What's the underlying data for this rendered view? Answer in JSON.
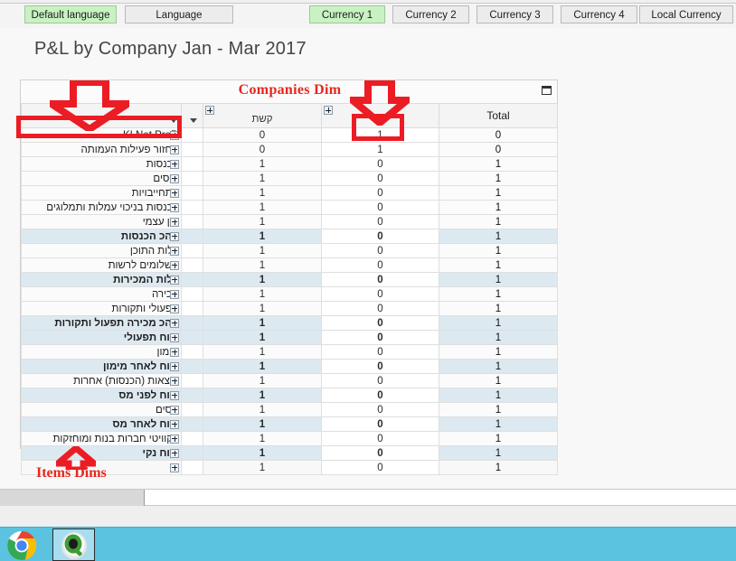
{
  "window": {
    "title": "P&L by Company Jan - Mar 2017"
  },
  "toolbar": {
    "language_tabs": [
      {
        "label": "Default language",
        "selected": true
      },
      {
        "label": "Language",
        "selected": false
      }
    ],
    "currency_tabs": [
      {
        "label": "Currency 1",
        "selected": true
      },
      {
        "label": "Currency 2",
        "selected": false
      },
      {
        "label": "Currency 3",
        "selected": false
      },
      {
        "label": "Currency 4",
        "selected": false
      },
      {
        "label": "Local Currency",
        "selected": false
      }
    ]
  },
  "pivot": {
    "caption": "Companies Dim",
    "maximize_icon": "maximize-icon",
    "headers": {
      "label": "",
      "tiny": "",
      "dim1": "קשת",
      "dim2": "",
      "total": "Total"
    },
    "rows": [
      {
        "label": "KI Net Profit",
        "dim1": "0",
        "dim2": "1",
        "total": "0",
        "highlight": false
      },
      {
        "label": "מחזור פעילות העמותה",
        "dim1": "0",
        "dim2": "1",
        "total": "0",
        "highlight": false
      },
      {
        "label": "הכנסות",
        "dim1": "1",
        "dim2": "0",
        "total": "1",
        "highlight": false
      },
      {
        "label": "נכסים",
        "dim1": "1",
        "dim2": "0",
        "total": "1",
        "highlight": false
      },
      {
        "label": "התחייבויות",
        "dim1": "1",
        "dim2": "0",
        "total": "1",
        "highlight": false
      },
      {
        "label": "הכנסות בניכוי עמלות ותמלוגים",
        "dim1": "1",
        "dim2": "0",
        "total": "1",
        "highlight": false
      },
      {
        "label": "הון עצמי",
        "dim1": "1",
        "dim2": "0",
        "total": "1",
        "highlight": false
      },
      {
        "label": "סהכ הכנסות",
        "dim1": "1",
        "dim2": "0",
        "total": "1",
        "highlight": true
      },
      {
        "label": "עלות התוכן",
        "dim1": "1",
        "dim2": "0",
        "total": "1",
        "highlight": false
      },
      {
        "label": "תשלומים לרשות",
        "dim1": "1",
        "dim2": "0",
        "total": "1",
        "highlight": false
      },
      {
        "label": "עלות המכירות",
        "dim1": "1",
        "dim2": "0",
        "total": "1",
        "highlight": true
      },
      {
        "label": "מכירה",
        "dim1": "1",
        "dim2": "0",
        "total": "1",
        "highlight": false
      },
      {
        "label": "תפעולי ותקורות",
        "dim1": "1",
        "dim2": "0",
        "total": "1",
        "highlight": false
      },
      {
        "label": "סהכ מכירה תפעול ותקורות",
        "dim1": "1",
        "dim2": "0",
        "total": "1",
        "highlight": true
      },
      {
        "label": "רווח תפעולי",
        "dim1": "1",
        "dim2": "0",
        "total": "1",
        "highlight": true
      },
      {
        "label": "מימון",
        "dim1": "1",
        "dim2": "0",
        "total": "1",
        "highlight": false
      },
      {
        "label": "רווח לאחר מימון",
        "dim1": "1",
        "dim2": "0",
        "total": "1",
        "highlight": true
      },
      {
        "label": "הוצאות (הכנסות) אחרות",
        "dim1": "1",
        "dim2": "0",
        "total": "1",
        "highlight": false
      },
      {
        "label": "רווח לפני מס",
        "dim1": "1",
        "dim2": "0",
        "total": "1",
        "highlight": true
      },
      {
        "label": "מסים",
        "dim1": "1",
        "dim2": "0",
        "total": "1",
        "highlight": false
      },
      {
        "label": "רווח לאחר מס",
        "dim1": "1",
        "dim2": "0",
        "total": "1",
        "highlight": true
      },
      {
        "label": "אקוויטי חברות בנות ומוחזקות",
        "dim1": "1",
        "dim2": "0",
        "total": "1",
        "highlight": false
      },
      {
        "label": "רווח נקי",
        "dim1": "1",
        "dim2": "0",
        "total": "1",
        "highlight": true
      },
      {
        "label": "",
        "dim1": "1",
        "dim2": "0",
        "total": "1",
        "highlight": false
      }
    ]
  },
  "annotations": {
    "accent_color": "#ec1c24",
    "items_dims_label": "Items Dims",
    "arrow_down_left": "arrow-down-icon",
    "arrow_down_right": "arrow-down-icon",
    "arrow_up_bottom": "arrow-up-icon",
    "highlight_box_row_label": "KI Net Profit",
    "highlight_box_cell_value": "1"
  },
  "taskbar": {
    "items": [
      {
        "name": "chrome-icon",
        "active": false
      },
      {
        "name": "qlikview-icon",
        "active": true
      }
    ]
  }
}
